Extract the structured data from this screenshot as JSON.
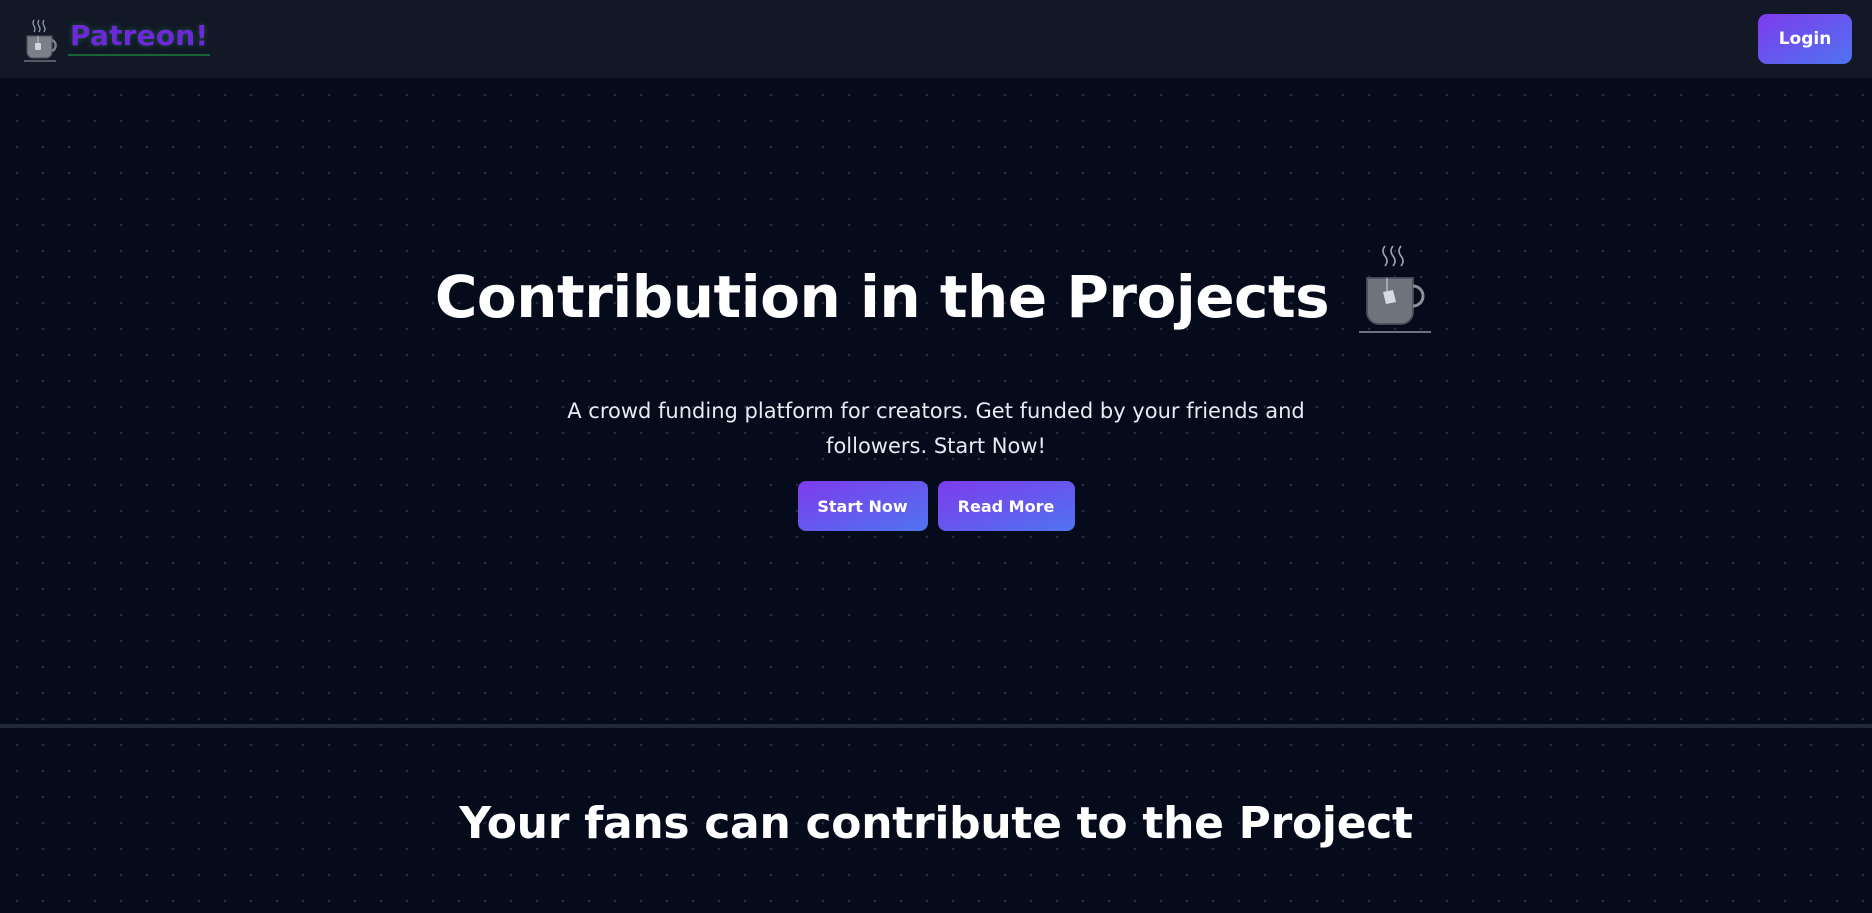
{
  "navbar": {
    "brand_text": "Patreon!",
    "brand_icon": "tea-cup-icon",
    "login_label": "Login"
  },
  "hero": {
    "title": "Contribution in the Projects",
    "title_icon": "tea-cup-icon",
    "subtitle": "A crowd funding platform for creators. Get funded by your friends and followers. Start Now!",
    "start_label": "Start Now",
    "read_more_label": "Read More"
  },
  "section": {
    "title": "Your fans can contribute to the Project"
  },
  "colors": {
    "background": "#060b1c",
    "navbar": "#121826",
    "brand": "#6d28d9",
    "button_gradient_start": "#7e3bed",
    "button_gradient_end": "#4f74f0"
  }
}
